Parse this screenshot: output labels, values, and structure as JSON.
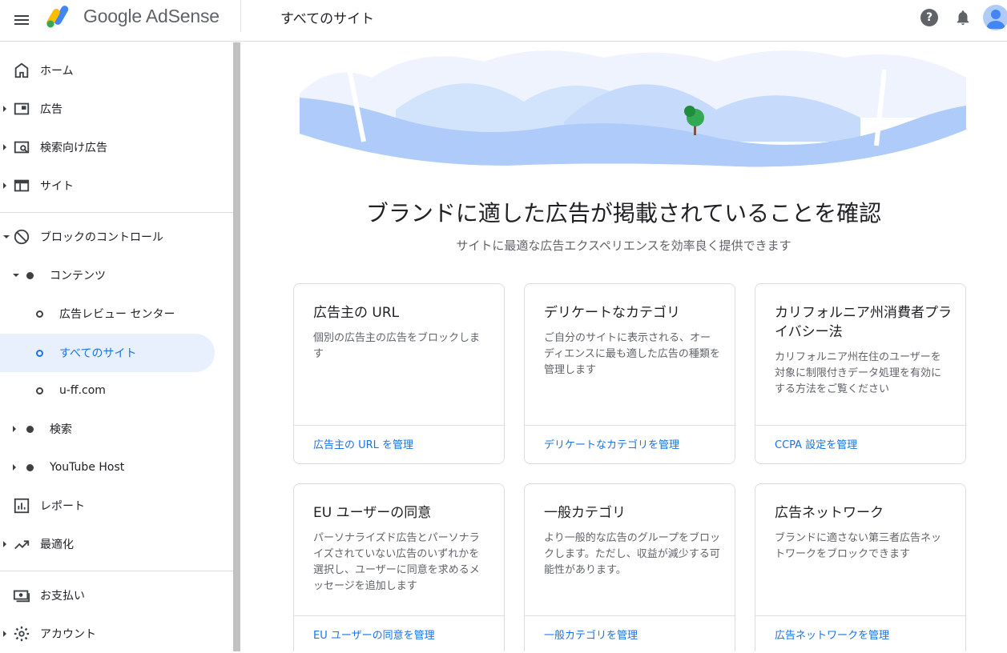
{
  "header": {
    "app_name_google": "Google",
    "app_name_product": "AdSense",
    "page_title": "すべてのサイト"
  },
  "sidebar": {
    "items": [
      {
        "label": "ホーム",
        "icon": "home-icon"
      },
      {
        "label": "広告",
        "icon": "ads-icon"
      },
      {
        "label": "検索向け広告",
        "icon": "search-ads-icon"
      },
      {
        "label": "サイト",
        "icon": "sites-icon"
      },
      {
        "label": "ブロックのコントロール",
        "icon": "block-icon"
      },
      {
        "label": "コンテンツ"
      },
      {
        "label": "広告レビュー センター"
      },
      {
        "label": "すべてのサイト"
      },
      {
        "label": "u-ff.com"
      },
      {
        "label": "検索"
      },
      {
        "label": "YouTube Host"
      },
      {
        "label": "レポート",
        "icon": "reports-icon"
      },
      {
        "label": "最適化",
        "icon": "optimization-icon"
      },
      {
        "label": "お支払い",
        "icon": "payments-icon"
      },
      {
        "label": "アカウント",
        "icon": "gear-icon"
      }
    ]
  },
  "main": {
    "headline": "ブランドに適した広告が掲載されていることを確認",
    "subheadline": "サイトに最適な広告エクスペリエンスを効率良く提供できます",
    "cards": [
      {
        "title": "広告主の URL",
        "desc": "個別の広告主の広告をブロックします",
        "link": "広告主の URL を管理"
      },
      {
        "title": "デリケートなカテゴリ",
        "desc": "ご自分のサイトに表示される、オーディエンスに最も適した広告の種類を管理します",
        "link": "デリケートなカテゴリを管理"
      },
      {
        "title": "カリフォルニア州消費者プライバシー法",
        "desc": "カリフォルニア州在住のユーザーを対象に制限付きデータ処理を有効にする方法をご覧ください",
        "link": "CCPA 設定を管理"
      },
      {
        "title": "EU ユーザーの同意",
        "desc": "パーソナライズド広告とパーソナライズされていない広告のいずれかを選択し、ユーザーに同意を求めるメッセージを追加します",
        "link": "EU ユーザーの同意を管理"
      },
      {
        "title": "一般カテゴリ",
        "desc": "より一般的な広告のグループをブロックします。ただし、収益が減少する可能性があります。",
        "link": "一般カテゴリを管理"
      },
      {
        "title": "広告ネットワーク",
        "desc": "ブランドに適さない第三者広告ネットワークをブロックできます",
        "link": "広告ネットワークを管理"
      }
    ]
  },
  "colors": {
    "accent": "#1a73e8",
    "active_bg": "#e8f0fe",
    "hero_blue": "#aecbfa"
  }
}
